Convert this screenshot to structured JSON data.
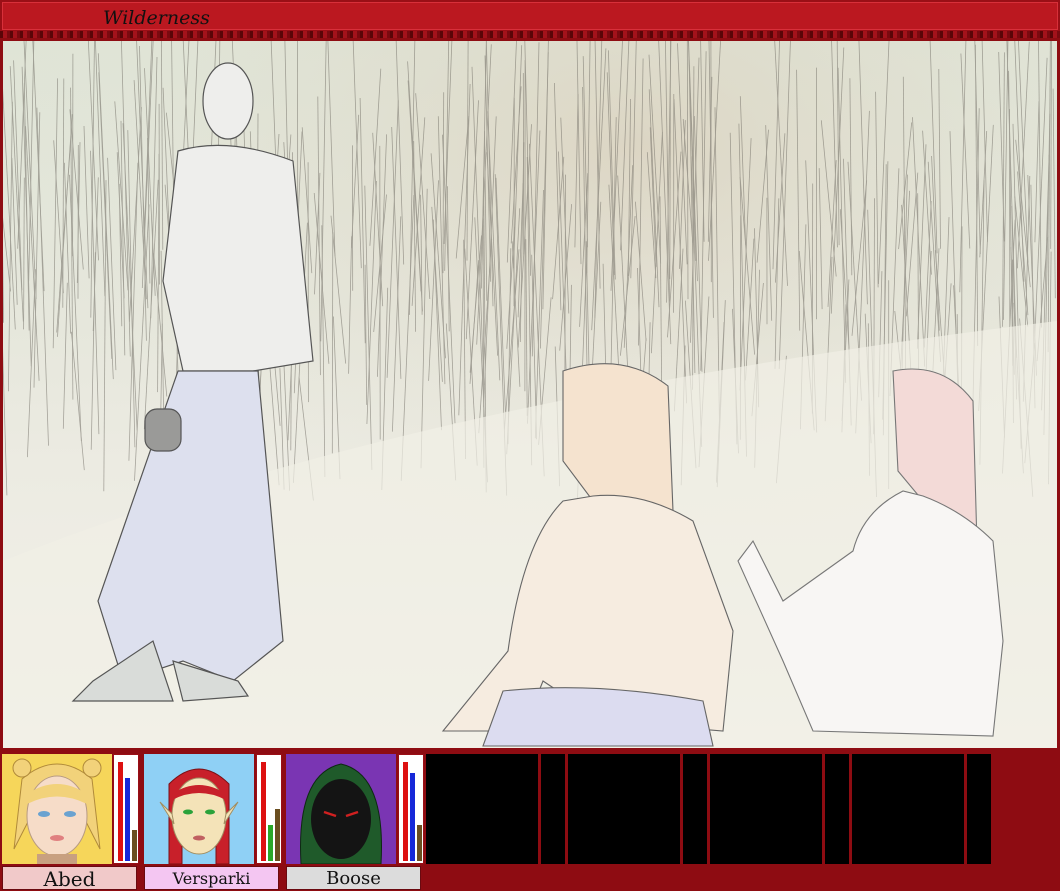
{
  "location": {
    "title": "Wilderness"
  },
  "party": [
    {
      "name": "Abed",
      "portrait_bg": "#f6d65a",
      "nameplate_bg": "#f1c9c9",
      "bars": [
        {
          "color": "#d11",
          "value": 0.95
        },
        {
          "color": "#1628d8",
          "value": 0.8
        },
        {
          "color": "#6a4e20",
          "value": 0.3
        }
      ]
    },
    {
      "name": "Versparki",
      "portrait_bg": "#8fd0f5",
      "nameplate_bg": "#f4c6f2",
      "bars": [
        {
          "color": "#d11",
          "value": 0.95
        },
        {
          "color": "#2aa82a",
          "value": 0.35
        },
        {
          "color": "#6a4e20",
          "value": 0.5
        }
      ]
    },
    {
      "name": "Boose",
      "portrait_bg": "#7a35b3",
      "nameplate_bg": "#dcdcdc",
      "bars": [
        {
          "color": "#d11",
          "value": 0.95
        },
        {
          "color": "#1628d8",
          "value": 0.85
        },
        {
          "color": "#6a4e20",
          "value": 0.35
        }
      ]
    }
  ],
  "empty_slot_count": 4
}
